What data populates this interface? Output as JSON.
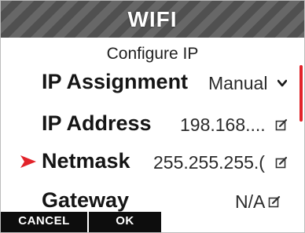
{
  "header": {
    "title": "WIFI"
  },
  "subtitle": "Configure IP",
  "rows": [
    {
      "label": "IP Assignment",
      "value": "Manual",
      "icon": "chevron-down-icon"
    },
    {
      "label": "IP Address",
      "value": "198.168....",
      "icon": "edit-icon"
    },
    {
      "label": "Netmask",
      "value": "255.255.255.(",
      "icon": "edit-icon",
      "selected": true
    },
    {
      "label": "Gateway",
      "value": "N/A",
      "icon": "edit-icon"
    }
  ],
  "softkeys": {
    "cancel": "CANCEL",
    "ok": "OK"
  },
  "colors": {
    "accent": "#e2232a",
    "header_bg": "#5b5b5b",
    "softkey_bg": "#0d0d0d"
  }
}
